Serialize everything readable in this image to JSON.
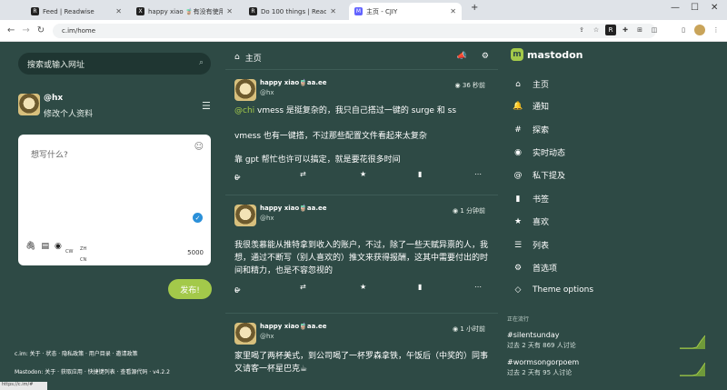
{
  "browser": {
    "tabs": [
      {
        "label": "Feed | Readwise",
        "fav": "R"
      },
      {
        "label": "happy xiao 🧋有没有使用...",
        "fav": "X"
      },
      {
        "label": "Do 100 things | Readwise",
        "fav": "R"
      },
      {
        "label": "主页 - CJIY",
        "fav": "M"
      }
    ],
    "new_tab": "+",
    "url": "c.im/home"
  },
  "left": {
    "search_placeholder": "搜索或输入网址",
    "user_handle": "@hx",
    "edit_profile": "修改个人资料",
    "compose_placeholder": "想写什么?",
    "cw": "CW",
    "lang_top": "ZH",
    "lang_bottom": "CN",
    "char_count": "5000",
    "publish": "发布!",
    "footer_line1": "c.im: 关于 · 状态 · 隐私政策 · 用户目录 · 邀请政策",
    "footer_line2": "Mastodon: 关于 · 获取应用 · 快捷键列表 · 查看源代码 · v4.2.2",
    "status_url": "https://c.im/#"
  },
  "center": {
    "header_title": "主页",
    "posts": [
      {
        "name": "happy xiao🧋aa.ee",
        "handle": "@hx",
        "time": "36 秒前",
        "mention": "@chi",
        "paragraphs": [
          "vmess 是挺复杂的，我只自己搭过一键的 surge 和 ss",
          "vmess 也有一键搭，不过那些配置文件看起来太复杂",
          "靠 gpt 帮忙也许可以搞定，就是要花很多时间"
        ],
        "replies": "0"
      },
      {
        "name": "happy xiao🧋aa.ee",
        "handle": "@hx",
        "time": "1 分钟前",
        "paragraphs": [
          "我很羡慕能从推特拿到收入的账户，不过，除了一些天赋异禀的人，我想，通过不断写（别人喜欢的）推文来获得报酬，这其中需要付出的时间和精力，也是不容忽视的"
        ],
        "replies": "0"
      },
      {
        "name": "happy xiao🧋aa.ee",
        "handle": "@hx",
        "time": "1 小时前",
        "paragraphs": [
          "家里喝了两杯美式，到公司喝了一杯罗森拿铁，午饭后（中奖的）同事又请客一杯星巴克☕"
        ],
        "replies": "0"
      }
    ]
  },
  "right": {
    "brand": "mastodon",
    "nav": [
      {
        "label": "主页",
        "icon": "home-icon"
      },
      {
        "label": "通知",
        "icon": "bell-icon"
      },
      {
        "label": "探索",
        "icon": "hashtag-icon"
      },
      {
        "label": "实时动态",
        "icon": "globe-icon"
      },
      {
        "label": "私下提及",
        "icon": "at-icon"
      },
      {
        "label": "书签",
        "icon": "bookmark-icon"
      },
      {
        "label": "喜欢",
        "icon": "star-icon"
      },
      {
        "label": "列表",
        "icon": "list-icon"
      },
      {
        "label": "首选项",
        "icon": "gear-icon"
      },
      {
        "label": "Theme options",
        "icon": "gem-icon"
      }
    ],
    "trends_heading": "正在流行",
    "trends": [
      {
        "tag": "#silentsunday",
        "meta": "过去 2 天有 869 人讨论",
        "spark": [
          0,
          0,
          0,
          0,
          1,
          8,
          14
        ]
      },
      {
        "tag": "#wormsongorpoem",
        "meta": "过去 2 天有 95 人讨论",
        "spark": [
          0,
          0,
          0,
          0,
          1,
          6,
          12
        ]
      }
    ]
  }
}
